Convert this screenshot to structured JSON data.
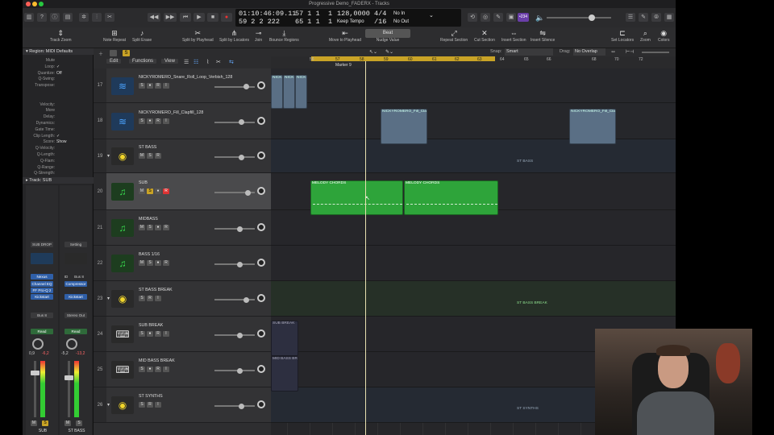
{
  "window": {
    "title": "Progressive Demo_FADERX - Tracks"
  },
  "lcd": {
    "time": "01:10:46:09.11",
    "bars": "59  2  2  222",
    "pos1": "57  1  1",
    "pos2": "65  1  1",
    "b1": "1",
    "b2": "1",
    "tempo": "128,0000",
    "tempo_label": "Keep Tempo",
    "sig": "4/4",
    "div": "/16",
    "in": "No In",
    "out": "No Out"
  },
  "cpu_badge": "•234",
  "toolbar": {
    "items": [
      "Track Zoom",
      "Note Repeat",
      "Split Erase",
      "Split by Playhead",
      "Split by Locators",
      "Join",
      "Bounce Regions",
      "Move to Playhead",
      "Nudge Value",
      "Repeat Section",
      "Cut Section",
      "Insert Section",
      "Insert Silence",
      "Set Locators",
      "Zoom",
      "Colors"
    ],
    "nudge": "Beat"
  },
  "menubar": {
    "edit": "Edit",
    "functions": "Functions",
    "view": "View",
    "snap_label": "Snap:",
    "snap_value": "Smart",
    "drag_label": "Drag:",
    "drag_value": "No Overlap"
  },
  "ruler": {
    "bars": [
      "56",
      "57",
      "58",
      "59",
      "60",
      "61",
      "62",
      "63",
      "64",
      "65",
      "66",
      "68",
      "70",
      "72"
    ],
    "marker": "Marker 9"
  },
  "inspector": {
    "region_title": "Region: MIDI Defaults",
    "rows": [
      [
        "Mute",
        ""
      ],
      [
        "Loop:",
        "✓"
      ],
      [
        "Quantize:",
        "Off"
      ],
      [
        "Q-Swing:",
        ""
      ],
      [
        "Transpose:",
        ""
      ],
      [
        "",
        ""
      ],
      [
        "",
        ""
      ],
      [
        "Velocity:",
        ""
      ],
      [
        "More",
        ""
      ],
      [
        "Delay:",
        ""
      ],
      [
        "Dynamics:",
        ""
      ],
      [
        "Gate Time:",
        ""
      ],
      [
        "Clip Length:",
        "✓"
      ],
      [
        "Score:",
        "Show"
      ],
      [
        "Q-Velocity:",
        ""
      ],
      [
        "Q-Length:",
        ""
      ],
      [
        "Q-Flam:",
        ""
      ],
      [
        "Q-Range:",
        ""
      ],
      [
        "Q-Strength:",
        ""
      ]
    ],
    "track_title": "Track: SUB",
    "strip1": {
      "name": "SUB DROP",
      "eq": "",
      "plug1": "Nexus",
      "plug2": "Channel EQ",
      "plug3": "FF Pro-Q 2",
      "plug4": "Kickstart",
      "send": "Bus 8",
      "mode": "Read",
      "vol": "0,9",
      "peak": "-6,2",
      "label": "SUB"
    },
    "strip2": {
      "setting": "Setting",
      "eq": "",
      "plug1": "Bus 8",
      "plug2": "Compressor",
      "plug3": "Kickstart",
      "out": "Stereo Out",
      "mode": "Read",
      "vol": "-5,2",
      "peak": "-13,2",
      "label": "ST BASS",
      "input": "ID"
    }
  },
  "tracks": [
    {
      "num": "17",
      "name": "NICKYROMERO_Snare_Roll_Loop_Verbish_128",
      "type": "audio"
    },
    {
      "num": "18",
      "name": "NICKYROMERO_Fill_Clapfill_128",
      "type": "audio"
    },
    {
      "num": "19",
      "name": "ST BASS",
      "type": "stack"
    },
    {
      "num": "20",
      "name": "SUB",
      "type": "midi",
      "selected": true
    },
    {
      "num": "21",
      "name": "MIDBASS",
      "type": "midi"
    },
    {
      "num": "22",
      "name": "BASS 1/16",
      "type": "midi"
    },
    {
      "num": "23",
      "name": "ST BASS BREAK",
      "type": "stack"
    },
    {
      "num": "24",
      "name": "SUB BREAK",
      "type": "keys"
    },
    {
      "num": "25",
      "name": "MID BASS BREAK",
      "type": "keys"
    },
    {
      "num": "26",
      "name": "ST SYNTHS",
      "type": "stack"
    }
  ],
  "regions": {
    "nick1": "NICK",
    "nick2": "NICK",
    "nick3": "NICK",
    "clap1": "NICKYROMERO_Fill_Clapf",
    "clap2": "NICKYROMERO_Fill_Clapfil",
    "stbass": "ST BASS",
    "melody1": "MELODY CHORDS",
    "melody2": "MELODY CHORDS",
    "stbassbreak": "ST BASS BREAK",
    "subbreak": "SUB BREAK",
    "midbassbreak": "MID BASS BR",
    "stsynths": "ST SYNTHS"
  },
  "colors": {
    "accent_yellow": "#e6c229",
    "midi_green": "#2ea43a",
    "selected_track": "#4a4a4c"
  }
}
